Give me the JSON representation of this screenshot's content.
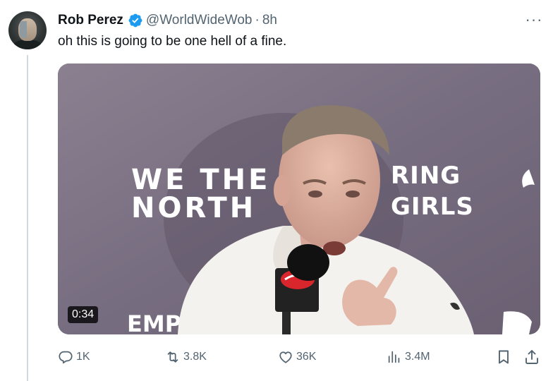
{
  "tweet": {
    "author_name": "Rob Perez",
    "handle": "@WorldWideWob",
    "separator": "·",
    "time": "8h",
    "text": "oh this is going to be one hell of a fine.",
    "more_label": "···"
  },
  "media": {
    "duration": "0:34",
    "backdrop_text": [
      "WE THE",
      "NORTH",
      "RING",
      "GIRLS",
      "EMPO"
    ]
  },
  "actions": {
    "replies": "1K",
    "reposts": "3.8K",
    "likes": "36K",
    "views": "3.4M"
  },
  "colors": {
    "text": "#0f1419",
    "secondary": "#536471",
    "verified": "#1d9bf0",
    "thread_line": "#cfd9de"
  },
  "icons": [
    "verified-badge-icon",
    "more-icon",
    "reply-icon",
    "repost-icon",
    "like-icon",
    "views-icon",
    "bookmark-icon",
    "share-icon"
  ]
}
